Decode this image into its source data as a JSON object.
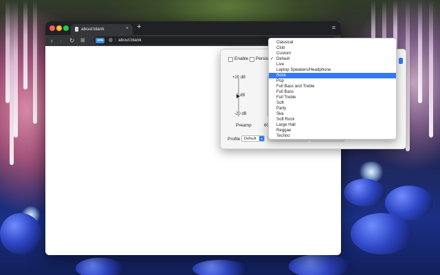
{
  "browser": {
    "tab_title": "about:blank",
    "tab_close": "×",
    "new_tab": "+",
    "menu_icon": "≡",
    "vpn_badge": "VPN",
    "url": "about:blank",
    "nav": {
      "back": "‹",
      "forward": "›",
      "reload": "↻",
      "grid": "⊞"
    }
  },
  "popup": {
    "enable_label": "Enable",
    "persist_label": "Persist",
    "db_top": "+20 dB",
    "db_mid": "0 dB",
    "db_bot": "-20 dB",
    "band_preamp": "Preamp",
    "band_60": "60",
    "profile_label": "Profile",
    "profile_value": "Default",
    "preamp_level_db": 0
  },
  "dropdown": {
    "options": [
      {
        "label": "Classical",
        "checked": false,
        "highlighted": false
      },
      {
        "label": "Club",
        "checked": false,
        "highlighted": false
      },
      {
        "label": "Custom",
        "checked": false,
        "highlighted": false
      },
      {
        "label": "Default",
        "checked": true,
        "highlighted": false
      },
      {
        "label": "Live",
        "checked": false,
        "highlighted": false
      },
      {
        "label": "Laptop Speakers/Headphone",
        "checked": false,
        "highlighted": false
      },
      {
        "label": "Rock",
        "checked": false,
        "highlighted": true
      },
      {
        "label": "Pop",
        "checked": false,
        "highlighted": false
      },
      {
        "label": "Full Bass and Treble",
        "checked": false,
        "highlighted": false
      },
      {
        "label": "Full Bass",
        "checked": false,
        "highlighted": false
      },
      {
        "label": "Full Treble",
        "checked": false,
        "highlighted": false
      },
      {
        "label": "Soft",
        "checked": false,
        "highlighted": false
      },
      {
        "label": "Party",
        "checked": false,
        "highlighted": false
      },
      {
        "label": "Ska",
        "checked": false,
        "highlighted": false
      },
      {
        "label": "Soft Rock",
        "checked": false,
        "highlighted": false
      },
      {
        "label": "Large Hall",
        "checked": false,
        "highlighted": false
      },
      {
        "label": "Reggae",
        "checked": false,
        "highlighted": false
      },
      {
        "label": "Techno",
        "checked": false,
        "highlighted": false
      }
    ],
    "check_glyph": "✓"
  },
  "colors": {
    "highlight": "#3478f6",
    "titlebar": "#202124",
    "toolbar": "#35363a"
  }
}
